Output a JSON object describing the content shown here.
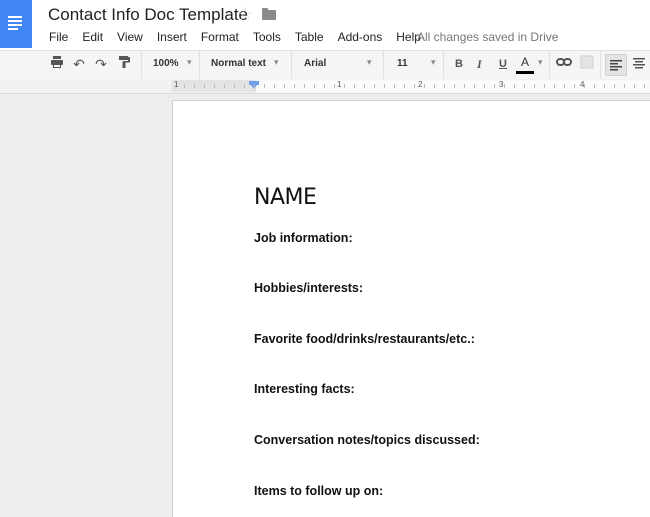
{
  "app": {
    "title": "Contact Info Doc Template",
    "save_status": "All changes saved in Drive"
  },
  "menu": [
    "File",
    "Edit",
    "View",
    "Insert",
    "Format",
    "Tools",
    "Table",
    "Add-ons",
    "Help"
  ],
  "toolbar": {
    "zoom": "100%",
    "style": "Normal text",
    "font": "Arial",
    "font_size": "11",
    "bold": "B",
    "italic": "I",
    "underline": "U",
    "text_color": "A",
    "text_color_value": "#000000"
  },
  "ruler": {
    "labels": [
      "1",
      "1",
      "2",
      "3",
      "4"
    ]
  },
  "document": {
    "heading": "NAME",
    "fields": [
      "Job information:",
      "Hobbies/interests:",
      "Favorite food/drinks/restaurants/etc.:",
      "Interesting facts:",
      "Conversation notes/topics discussed:",
      "Items to follow up on:"
    ]
  },
  "colors": {
    "brand": "#4285f4",
    "indent_marker": "#6d9eeb"
  }
}
